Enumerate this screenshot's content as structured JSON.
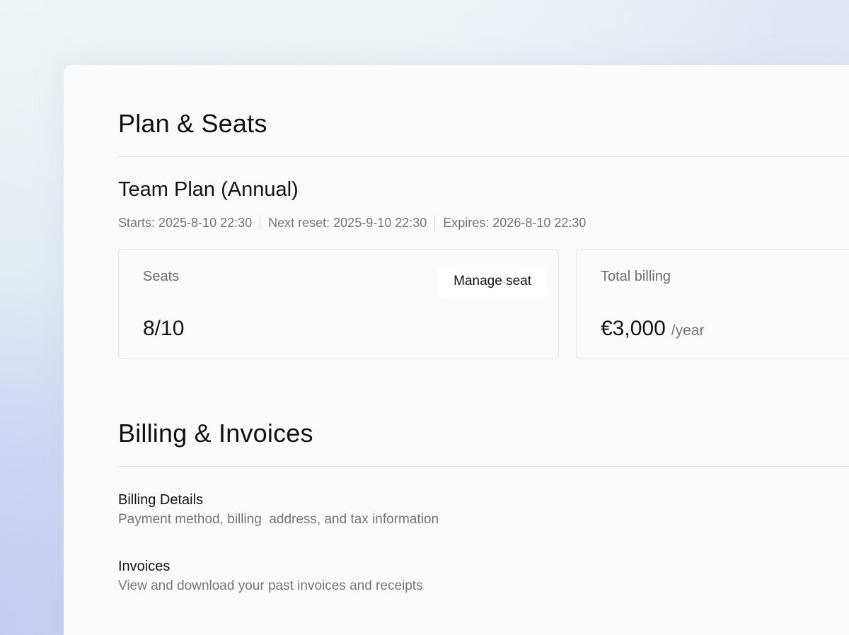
{
  "plan_section": {
    "title": "Plan & Seats",
    "plan_name": "Team Plan (Annual)",
    "meta": {
      "starts": "Starts: 2025-8-10 22:30",
      "next_reset": "Next reset: 2025-9-10 22:30",
      "expires": "Expires: 2026-8-10 22:30"
    },
    "seats_card": {
      "label": "Seats",
      "value": "8/10",
      "button_label": "Manage seat"
    },
    "billing_card": {
      "label": "Total billing",
      "amount": "€3,000",
      "period": "/year"
    }
  },
  "billing_section": {
    "title": "Billing & Invoices",
    "items": [
      {
        "title": "Billing Details",
        "description": "Payment method, billing  address, and tax information"
      },
      {
        "title": "Invoices",
        "description": "View and download your past invoices and receipts"
      }
    ]
  }
}
